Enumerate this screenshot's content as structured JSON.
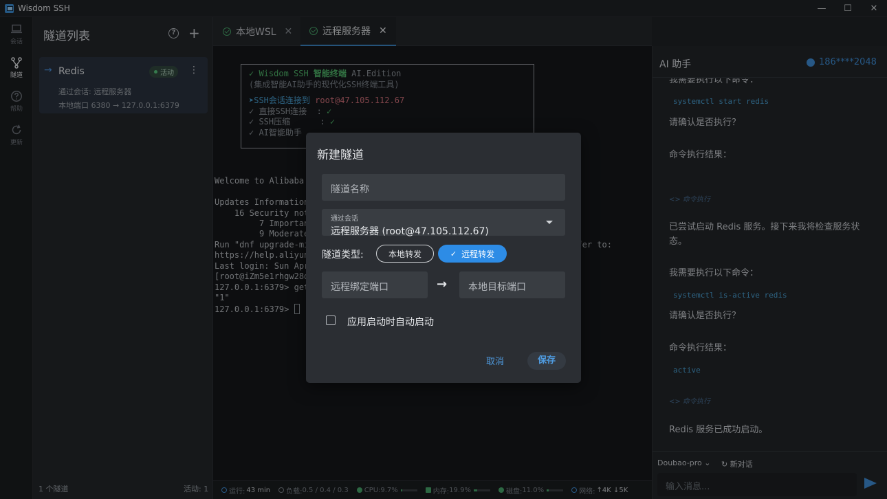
{
  "window": {
    "title": "Wisdom SSH",
    "controls": [
      "—",
      "☐",
      "✕"
    ]
  },
  "activity": [
    {
      "label": "会话",
      "icon": "laptop-icon",
      "active": false
    },
    {
      "label": "隧道",
      "icon": "tunnel-icon",
      "active": true
    },
    {
      "label": "帮助",
      "icon": "help-icon",
      "active": false
    },
    {
      "label": "更新",
      "icon": "update-icon",
      "active": false
    }
  ],
  "sidebar": {
    "title": "隧道列表",
    "help_glyph": "?",
    "add_glyph": "+",
    "tunnel": {
      "arrow": "→",
      "name": "Redis",
      "status": "活动",
      "menu": "⋮",
      "session": "通过会话: 远程服务器",
      "mapping": "本地端口 6380 → 127.0.0.1:6379"
    },
    "footer_count": "1 个隧道",
    "footer_active": "活动: 1"
  },
  "tabs": [
    {
      "label": "本地WSL",
      "close": "✕"
    },
    {
      "label": "远程服务器",
      "close": "✕"
    }
  ],
  "terminal": {
    "banner": {
      "l1_check": "✓ Wisdom SSH ",
      "l1_strong": "智能终端",
      "l1_suffix": " AI.Edition",
      "l2": "(集成智能AI助手的现代化SSH终端工具)",
      "l3_prefix": "➤SSH会话连接到 ",
      "l3_host": "root@47.105.112.67",
      "l4_label": "✓ 直接SSH连接  : ",
      "l4_mark": "✓",
      "l5_label": "✓ SSH压缩      : ",
      "l5_mark": "✓",
      "l6_label": "✓ AI智能助手"
    },
    "lines": [
      "Welcome to Alibaba",
      "",
      "Updates Information",
      "    16 Security not",
      "         7 Importan",
      "         9 Moderate",
      "Run \"dnf upgrade-mi                                                  e refer to:",
      "https://help.aliyun",
      "Last login: Sun Apr",
      "[root@iZm5e1rhgw28d",
      "127.0.0.1:6379> get",
      "\"1\"",
      "127.0.0.1:6379> "
    ]
  },
  "statusbar": {
    "uptime_label": "运行:",
    "uptime_value": "43 min",
    "load_label": "负载:",
    "load_value": "0.5 / 0.4 / 0.3",
    "cpu_label": "CPU:",
    "cpu_value": "9.7%",
    "cpu_fraction": 0.097,
    "mem_label": "内存:",
    "mem_value": "19.9%",
    "mem_fraction": 0.199,
    "disk_label": "磁盘:",
    "disk_value": "11.0%",
    "disk_fraction": 0.11,
    "net_label": "网络:",
    "net_value": "↑4K ↓5K"
  },
  "ai": {
    "title": "AI 助手",
    "user": "186****2048",
    "messages": {
      "m1": "我需要执行以下命令：",
      "c1": "systemctl start redis",
      "m2": "请确认是否执行？",
      "m3": "命令执行结果：",
      "link1": "<> 命令执行",
      "m4a": "已尝试启动 Redis 服务。接下来我将检查服务状",
      "m4b": "态。",
      "m5": "我需要执行以下命令：",
      "c2": "systemctl is-active redis",
      "m6": "请确认是否执行？",
      "m7": "命令执行结果：",
      "c3": "active",
      "link2": "<> 命令执行",
      "m8": "Redis 服务已成功启动。"
    },
    "model": "Doubao-pro ⌄",
    "new_chat": "↻ 新对话",
    "input_placeholder": "输入消息..."
  },
  "modal": {
    "title": "新建隧道",
    "name_placeholder": "隧道名称",
    "session_label": "通过会话",
    "session_value": "远程服务器 (root@47.105.112.67)",
    "type_label": "隧道类型:",
    "type_local": "本地转发",
    "type_remote": "远程转发",
    "type_selected_mark": "✓",
    "remote_port_placeholder": "远程绑定端口",
    "arrow": "→",
    "local_target_placeholder": "本地目标端口",
    "autostart_label": "应用启动时自动启动",
    "cancel": "取消",
    "save": "保存"
  },
  "colors": {
    "accent": "#2d8ce6",
    "success": "#4aa96c",
    "host_pink": "#d2707a"
  }
}
